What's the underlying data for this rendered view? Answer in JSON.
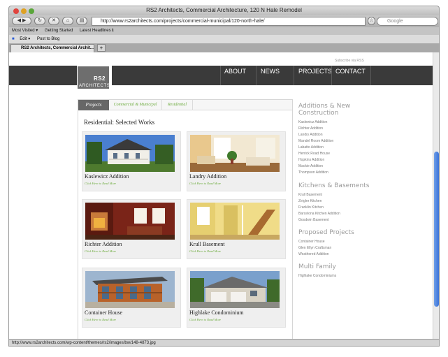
{
  "window": {
    "title": "RS2 Architects, Commercial Architecture, 120 N Hale Remodel"
  },
  "toolbar": {
    "url": "http://www.rs2architects.com/projects/commercial-municipal/120-north-hale/",
    "search_placeholder": "Google"
  },
  "bookmarks": [
    "Most Visited ▾",
    "Getting Started",
    "Latest Headlines ℹ"
  ],
  "extension_bar": {
    "edit": "Edit ▾",
    "post": "Post to Blog"
  },
  "tab": {
    "label": "RS2 Architects, Commercial Archit..."
  },
  "site": {
    "subscribe": "Subscribe via RSS",
    "logo": {
      "line1": "RS2",
      "line2": "ARCHITECTS"
    },
    "nav": [
      "ABOUT",
      "NEWS",
      "PROJECTS",
      "CONTACT"
    ]
  },
  "panel": {
    "tabs": [
      "Projects",
      "Commercial & Municipal",
      "Residential"
    ],
    "heading": "Residential: Selected Works",
    "link_label": "Click Here to Read More",
    "cards": [
      {
        "title": "Kaslewicz Addition"
      },
      {
        "title": "Landry Addition"
      },
      {
        "title": "Richter Addition"
      },
      {
        "title": "Krull Basement"
      },
      {
        "title": "Container House"
      },
      {
        "title": "Highlake Condominium"
      }
    ]
  },
  "sidebar": {
    "sections": [
      {
        "heading_lines": [
          "Additions & New",
          "Construction"
        ],
        "items": [
          "Kaslewicz Addition",
          "Richter Addition",
          "Landry Addition",
          "Mandel Room Addition",
          "Labatto Addition",
          "Herrick Road House",
          "Hopkins Addition",
          "Mackie Addition",
          "Thompson Addition"
        ]
      },
      {
        "heading_lines": [
          "Kitchens & Basements"
        ],
        "items": [
          "Krull Basement",
          "Zeigler Kitchen",
          "Franklin Kitchen",
          "Barcelona Kitchen Addition",
          "Goodwin Basement"
        ]
      },
      {
        "heading_lines": [
          "Proposed Projects"
        ],
        "items": [
          "Container House",
          "Glen Ellyn Craftsman",
          "Weathered Addition"
        ]
      },
      {
        "heading_lines": [
          "Multi Family"
        ],
        "items": [
          "Highlake Condominiums"
        ]
      }
    ]
  },
  "status": {
    "text": "http://www.rs2architects.com/wp-content/themes/rs2/images/bw/148-4873.jpg"
  }
}
